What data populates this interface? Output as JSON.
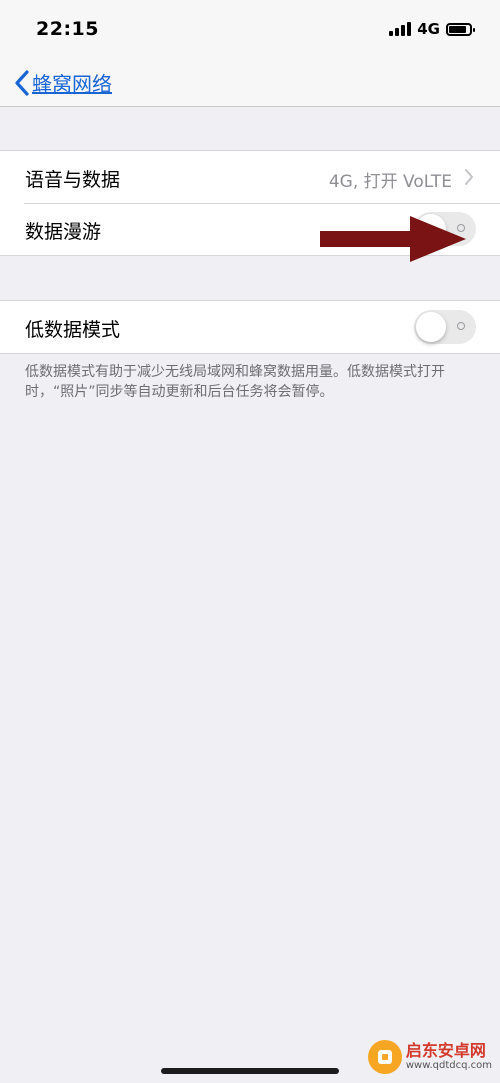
{
  "status_bar": {
    "time": "22:15",
    "network": "4G"
  },
  "nav": {
    "back_label": "蜂窝网络"
  },
  "group1": {
    "rows": [
      {
        "label": "语音与数据",
        "value": "4G, 打开 VoLTE"
      },
      {
        "label": "数据漫游",
        "toggle_on": false
      }
    ]
  },
  "group2": {
    "rows": [
      {
        "label": "低数据模式",
        "toggle_on": false
      }
    ],
    "footer": "低数据模式有助于减少无线局域网和蜂窝数据用量。低数据模式打开时，“照片”同步等自动更新和后台任务将会暂停。"
  },
  "annotation": {
    "arrow_color": "#7a1414"
  },
  "watermark": {
    "title": "启东安卓网",
    "url": "www.qdtdcq.com"
  },
  "colors": {
    "accent": "#1a65d6",
    "background": "#efeff4"
  }
}
